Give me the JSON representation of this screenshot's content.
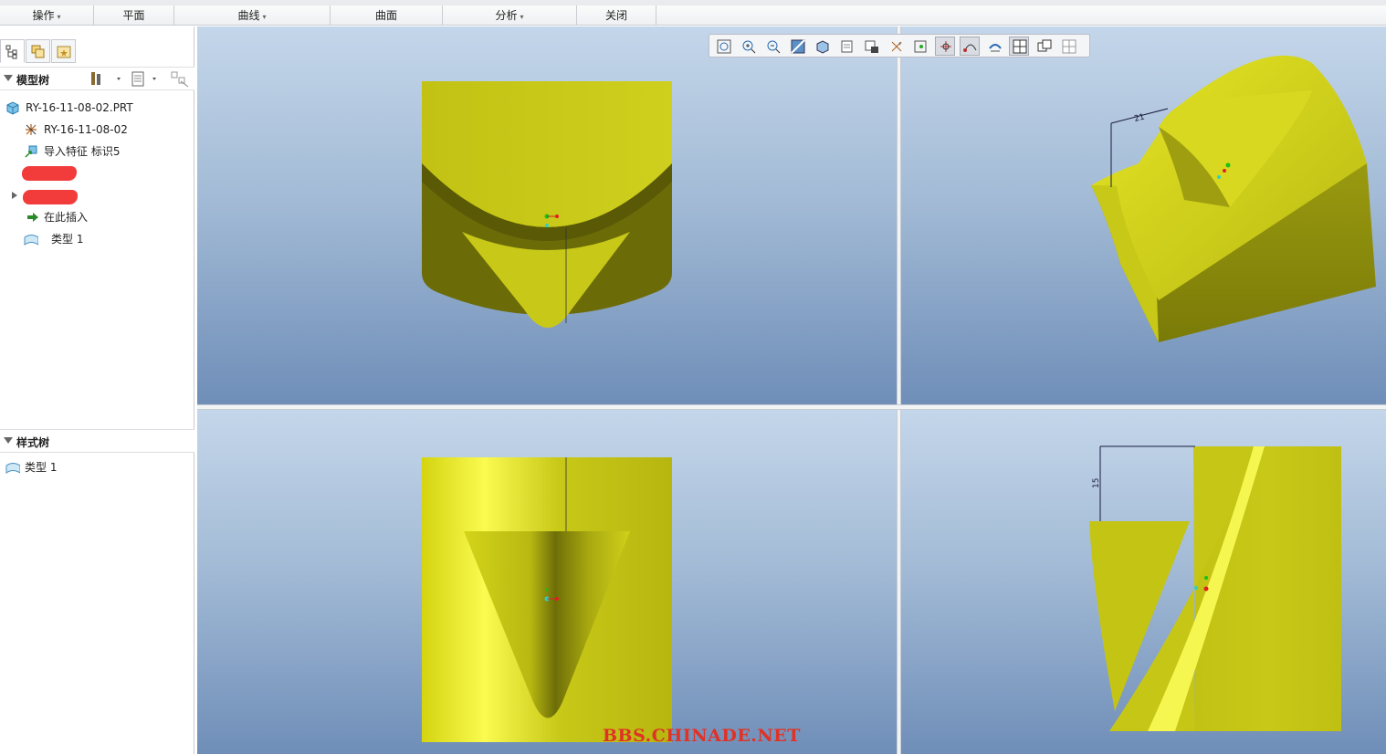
{
  "menubar": {
    "groups": [
      {
        "label": "操作",
        "caret": "▾"
      },
      {
        "label": "平面",
        "caret": ""
      },
      {
        "label": "曲线",
        "caret": "▾"
      },
      {
        "label": "曲面",
        "caret": ""
      },
      {
        "label": "分析",
        "caret": "▾"
      },
      {
        "label": "关闭",
        "caret": ""
      }
    ]
  },
  "left_panel": {
    "tabs": [
      "model-tree-tab",
      "layers-tab",
      "favorites-tab"
    ],
    "model_tree": {
      "title": "模型树",
      "items": [
        {
          "label": "RY-16-11-08-02.PRT",
          "icon": "part-icon"
        },
        {
          "label": "RY-16-11-08-02",
          "icon": "csys-icon"
        },
        {
          "label": "导入特征 标识5",
          "icon": "import-feature-icon"
        },
        {
          "label": "",
          "icon": "redacted"
        },
        {
          "label": "",
          "icon": "redacted"
        },
        {
          "label": "在此插入",
          "icon": "insert-here-arrow-icon"
        },
        {
          "label": "类型 1",
          "icon": "style-feature-icon"
        }
      ]
    },
    "style_tree": {
      "title": "样式树",
      "items": [
        {
          "label": "类型 1",
          "icon": "style-feature-icon"
        }
      ]
    }
  },
  "view_toolbar": {
    "tools": [
      "refit-icon",
      "zoom-in-icon",
      "zoom-out-icon",
      "repaint-icon",
      "display-style-icon",
      "saved-views-icon",
      "view-manager-icon",
      "datum-display-icon",
      "spin-center-icon",
      "annotation-display-icon",
      "curvature-display-icon",
      "orient-icon",
      "four-views-icon",
      "active-view-icon",
      "tile-view-icon",
      "mirror-icon"
    ],
    "active": [
      9,
      10,
      12
    ]
  },
  "viewports": {
    "top_right_dimension": "21",
    "bottom_right_dimension": "15"
  },
  "colors": {
    "model_yellow": "#c8c818",
    "model_dark": "#6b6b08",
    "bg_top": "#c4d6ea",
    "bg_bottom": "#6f8eb8",
    "redaction": "#f23b3b"
  },
  "watermark": "BBS.CHINADE.NET"
}
